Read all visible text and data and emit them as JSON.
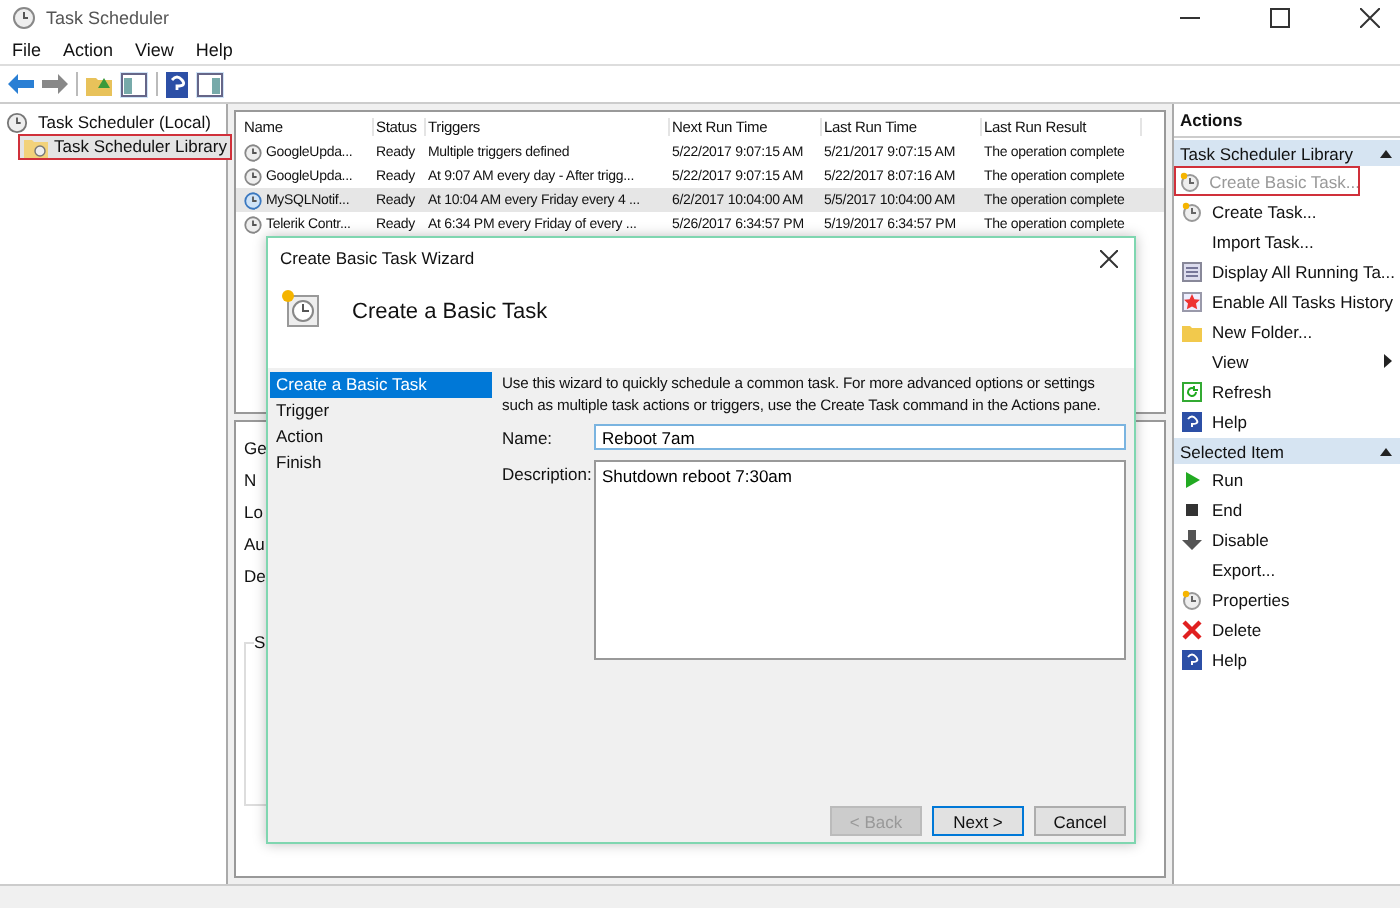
{
  "window": {
    "title": "Task Scheduler"
  },
  "menu": [
    "File",
    "Action",
    "View",
    "Help"
  ],
  "tree": [
    {
      "label": "Task Scheduler (Local)",
      "selected": false,
      "highlighted": false,
      "children": [
        {
          "label": "Task Scheduler Library",
          "expanded": false,
          "selected": true,
          "highlighted": true
        }
      ]
    }
  ],
  "table": {
    "columns": [
      "Name",
      "Status",
      "Triggers",
      "Next Run Time",
      "Last Run Time",
      "Last Run Result"
    ],
    "rows": [
      {
        "selected": false,
        "cells": [
          "GoogleUpda...",
          "Ready",
          "Multiple triggers defined",
          "5/22/2017 9:07:15 AM",
          "5/21/2017 9:07:15 AM",
          "The operation complete"
        ]
      },
      {
        "selected": false,
        "cells": [
          "GoogleUpda...",
          "Ready",
          "At 9:07 AM every day - After trigg...",
          "5/22/2017 9:07:15 AM",
          "5/22/2017 8:07:16 AM",
          "The operation complete"
        ]
      },
      {
        "selected": true,
        "cells": [
          "MySQLNotif...",
          "Ready",
          "At 10:04 AM every Friday every 4 ...",
          "6/2/2017 10:04:00 AM",
          "5/5/2017 10:04:00 AM",
          "The operation complete"
        ]
      },
      {
        "selected": false,
        "cells": [
          "Telerik Contr...",
          "Ready",
          "At 6:34 PM every Friday of every ...",
          "5/26/2017 6:34:57 PM",
          "5/19/2017 6:34:57 PM",
          "The operation complete"
        ]
      }
    ]
  },
  "details": {
    "tab": "Ge",
    "labels": [
      "N",
      "Lo",
      "Au",
      "De"
    ],
    "group": "S"
  },
  "actions": {
    "title": "Actions",
    "sections": [
      {
        "title": "Task Scheduler Library",
        "expanded": true,
        "items": [
          {
            "label": "Create Basic Task...",
            "disabled": true,
            "highlighted": true,
            "submenu": false
          },
          {
            "label": "Create Task...",
            "disabled": false,
            "highlighted": false,
            "submenu": false
          },
          {
            "label": "Import Task...",
            "disabled": false,
            "highlighted": false,
            "submenu": false
          },
          {
            "label": "Display All Running Ta...",
            "disabled": false,
            "highlighted": false,
            "submenu": false
          },
          {
            "label": "Enable All Tasks History",
            "disabled": false,
            "highlighted": false,
            "submenu": false
          },
          {
            "label": "New Folder...",
            "disabled": false,
            "highlighted": false,
            "submenu": false
          },
          {
            "label": "View",
            "disabled": false,
            "highlighted": false,
            "submenu": true
          },
          {
            "label": "Refresh",
            "disabled": false,
            "highlighted": false,
            "submenu": false
          },
          {
            "label": "Help",
            "disabled": false,
            "highlighted": false,
            "submenu": false
          }
        ]
      },
      {
        "title": "Selected Item",
        "expanded": true,
        "items": [
          {
            "label": "Run",
            "disabled": false,
            "highlighted": false,
            "submenu": false
          },
          {
            "label": "End",
            "disabled": false,
            "highlighted": false,
            "submenu": false
          },
          {
            "label": "Disable",
            "disabled": false,
            "highlighted": false,
            "submenu": false
          },
          {
            "label": "Export...",
            "disabled": false,
            "highlighted": false,
            "submenu": false
          },
          {
            "label": "Properties",
            "disabled": false,
            "highlighted": false,
            "submenu": false
          },
          {
            "label": "Delete",
            "disabled": false,
            "highlighted": false,
            "submenu": false
          },
          {
            "label": "Help",
            "disabled": false,
            "highlighted": false,
            "submenu": false
          }
        ]
      }
    ]
  },
  "dialog": {
    "title": "Create Basic Task Wizard",
    "heading": "Create a Basic Task",
    "steps": [
      {
        "label": "Create a Basic Task",
        "selected": true
      },
      {
        "label": "Trigger",
        "selected": false
      },
      {
        "label": "Action",
        "selected": false
      },
      {
        "label": "Finish",
        "selected": false
      }
    ],
    "intro": "Use this wizard to quickly schedule a common task.  For more advanced options or settings such as multiple task actions or triggers, use the Create Task command in the Actions pane.",
    "name_label": "Name:",
    "name_value": "Reboot 7am",
    "description_label": "Description:",
    "description_value": "Shutdown reboot 7:30am",
    "buttons": [
      {
        "label": "< Back",
        "disabled": true,
        "default": false
      },
      {
        "label": "Next >",
        "disabled": false,
        "default": true
      },
      {
        "label": "Cancel",
        "disabled": false,
        "default": false
      }
    ]
  }
}
